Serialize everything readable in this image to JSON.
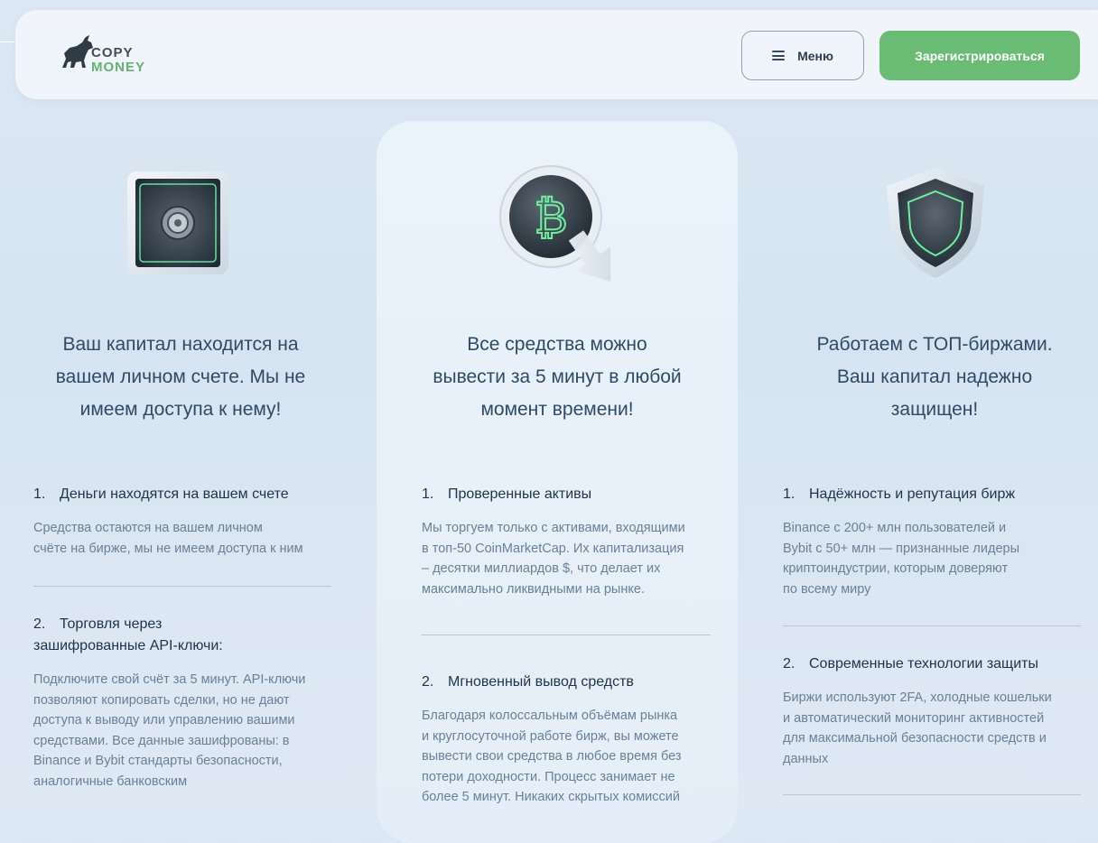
{
  "header": {
    "logo_top": "COPY",
    "logo_bottom": "MONEY",
    "menu_label": "Меню",
    "register_label": "Зарегистрироваться"
  },
  "colors": {
    "accent_green": "#6abc74",
    "title_blue": "#2f4a66",
    "text_gray": "#6a8096"
  },
  "columns": [
    {
      "icon": "safe-icon",
      "title_lines": [
        "Ваш капитал находится на",
        "вашем личном счете. Мы не",
        "имеем доступа к нему!"
      ],
      "items": [
        {
          "num": "1.",
          "title_lines": [
            "Деньги находятся на вашем счете"
          ],
          "text_lines": [
            "Средства остаются на вашем личном",
            "счёте на бирже, мы не имеем доступа к ним"
          ]
        },
        {
          "num": "2.",
          "title_lines": [
            "Торговля через",
            "зашифрованные API-ключи:"
          ],
          "text_lines": [
            "Подключите свой счёт за 5 минут. API-ключи",
            "позволяют копировать сделки, но не дают",
            "доступа к выводу или управлению вашими",
            "средствами. Все данные зашифрованы: в",
            "Binance и Bybit стандарты безопасности,",
            "аналогичные банковским"
          ]
        }
      ]
    },
    {
      "icon": "bitcoin-withdraw-icon",
      "title_lines": [
        "Все средства можно",
        "вывести за 5 минут в любой",
        "момент времени!"
      ],
      "items": [
        {
          "num": "1.",
          "title_lines": [
            "Проверенные активы"
          ],
          "text_lines": [
            "Мы торгуем только с активами, входящими",
            "в топ-50 CoinMarketCap. Их капитализация",
            "– десятки миллиардов $, что делает их",
            "максимально ликвидными на рынке."
          ]
        },
        {
          "num": "2.",
          "title_lines": [
            "Мгновенный вывод средств"
          ],
          "text_lines": [
            "Благодаря колоссальным объёмам рынка",
            "и круглосуточной работе бирж, вы можете",
            "вывести свои средства в любое время без",
            "потери доходности. Процесс занимает не",
            "более 5 минут. Никаких скрытых комиссий"
          ]
        }
      ]
    },
    {
      "icon": "shield-icon",
      "title_lines": [
        "Работаем с ТОП-биржами.",
        "Ваш капитал надежно",
        "защищен!"
      ],
      "items": [
        {
          "num": "1.",
          "title_lines": [
            "Надёжность и репутация бирж"
          ],
          "text_lines": [
            "Binance с 200+ млн пользователей и",
            "Bybit с 50+ млн — признанные лидеры",
            "криптоиндустрии, которым доверяют",
            "по всему миру"
          ]
        },
        {
          "num": "2.",
          "title_lines": [
            "Современные технологии защиты"
          ],
          "text_lines": [
            "Биржи используют 2FA, холодные кошельки",
            "и автоматический мониторинг активностей",
            "для максимальной безопасности средств и",
            "данных"
          ]
        }
      ]
    }
  ]
}
